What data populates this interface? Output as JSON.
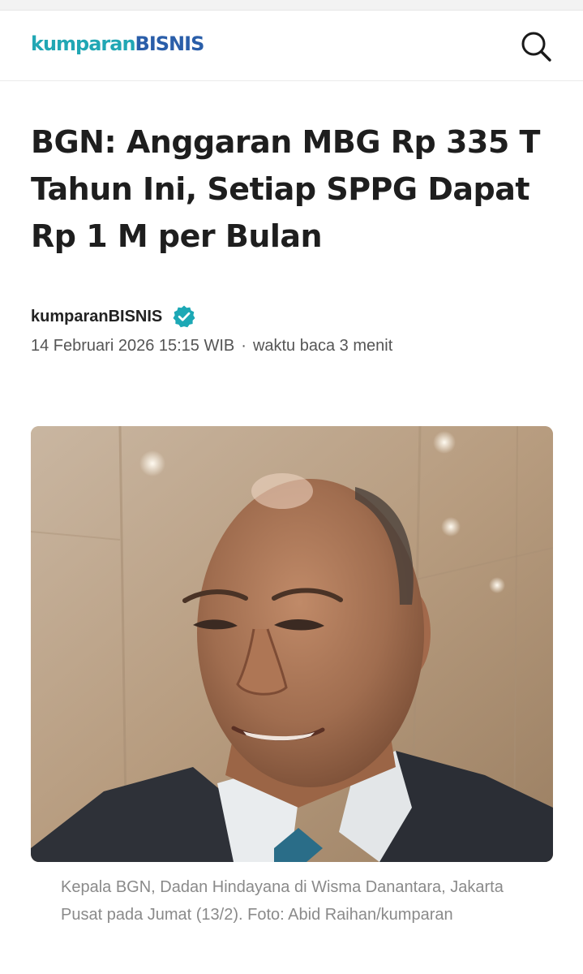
{
  "header": {
    "logo_brand": "kumparan",
    "logo_section": "BISNIS",
    "search_icon": "search-icon"
  },
  "article": {
    "title": "BGN: Anggaran MBG Rp 335 T Tahun Ini, Setiap SPPG Dapat Rp 1 M per Bulan",
    "author": "kumparanBISNIS",
    "verified_icon": "verified-check-icon",
    "date": "14 Februari 2026 15:15 WIB",
    "separator": "·",
    "read_time": "waktu baca 3 menit",
    "caption": "Kepala BGN, Dadan Hindayana di Wisma Danantara, Jakarta Pusat pada Jumat (13/2). Foto: Abid Raihan/kumparan"
  },
  "colors": {
    "brand_teal": "#21a7b4",
    "brand_blue": "#2a5ea9",
    "verified_badge": "#1ca8b5",
    "title_text": "#1e1e1e",
    "caption_text": "#8a8a8a"
  }
}
